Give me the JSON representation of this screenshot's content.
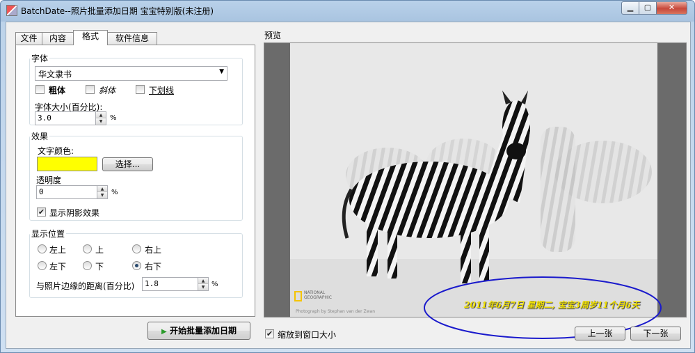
{
  "window": {
    "title": "BatchDate--照片批量添加日期 宝宝特别版(未注册)",
    "minimize_glyph": "▁",
    "maximize_glyph": "▢",
    "close_glyph": "✕"
  },
  "tabs": [
    {
      "label": "文件",
      "active": false
    },
    {
      "label": "内容",
      "active": false
    },
    {
      "label": "格式",
      "active": true
    },
    {
      "label": "软件信息",
      "active": false
    }
  ],
  "font_group": {
    "legend": "字体",
    "font_name": "华文隶书",
    "bold_label": "粗体",
    "bold_checked": false,
    "italic_label": "斜体",
    "italic_checked": false,
    "underline_label": "下划线",
    "underline_checked": false,
    "size_label": "字体大小(百分比):",
    "size_value": "3.0",
    "size_unit": "%"
  },
  "effect_group": {
    "legend": "效果",
    "color_label": "文字颜色:",
    "color_value": "#ffff00",
    "choose_button": "选择...",
    "opacity_label": "透明度",
    "opacity_value": "0",
    "opacity_unit": "%",
    "shadow_label": "显示阴影效果",
    "shadow_checked": true
  },
  "position_group": {
    "legend": "显示位置",
    "options": [
      "左上",
      "上",
      "右上",
      "左下",
      "下",
      "右下"
    ],
    "selected": "右下",
    "margin_label": "与照片边缘的距离(百分比)",
    "margin_value": "1.8",
    "margin_unit": "%"
  },
  "start_button": "开始批量添加日期",
  "preview": {
    "label": "预览",
    "date_overlay": "2011年6月7日  星期二, 宝宝3周岁11个月6天",
    "ng_text": "NATIONAL\nGEOGRAPHIC",
    "credit": "Photograph by Stephan van der Zwan"
  },
  "fit_window_label": "缩放到窗口大小",
  "fit_window_checked": true,
  "prev_button": "上一张",
  "next_button": "下一张",
  "colors": {
    "accent_annotation": "#1a1acc",
    "start_icon": "#2a9a2a"
  }
}
